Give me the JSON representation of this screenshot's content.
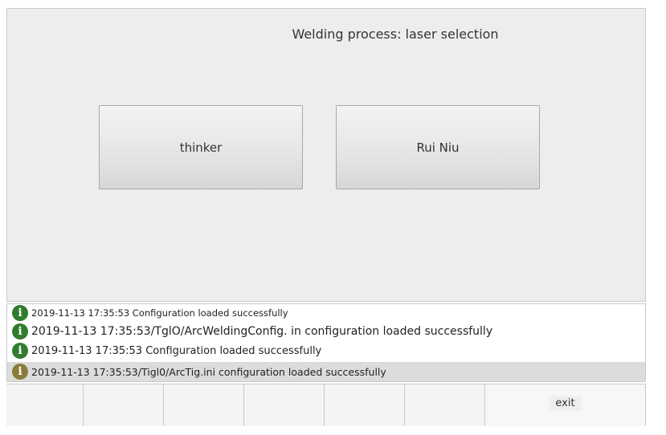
{
  "main": {
    "title": "Welding process: laser selection",
    "choices": [
      {
        "label": "thinker"
      },
      {
        "label": "Rui Niu"
      }
    ]
  },
  "log": {
    "entries": [
      {
        "icon": "info-icon",
        "text": "2019-11-13 17:35:53 Configuration loaded successfully"
      },
      {
        "icon": "info-icon",
        "text": "2019-11-13 17:35:53/TglO/ArcWeldingConfig. in configuration loaded successfully"
      },
      {
        "icon": "info-icon",
        "text": "2019-11-13 17:35:53 Configuration loaded successfully"
      },
      {
        "icon": "info-icon",
        "text": "2019-11-13 17:35:53/Tigl0/ArcTig.ini configuration loaded successfully"
      }
    ]
  },
  "toolbar": {
    "exit_label": "exit"
  }
}
